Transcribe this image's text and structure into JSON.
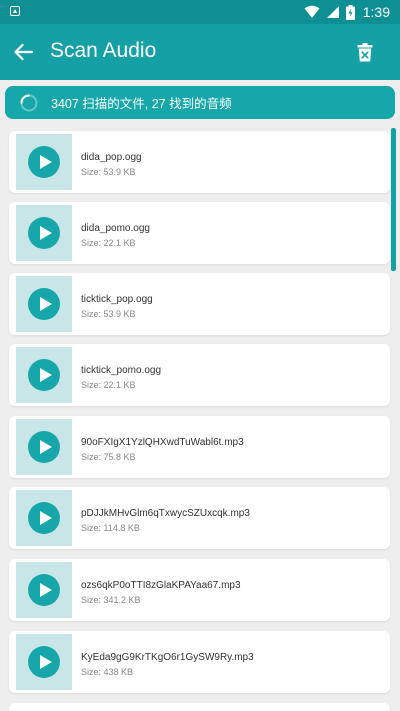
{
  "status_bar": {
    "time": "1:39"
  },
  "app_bar": {
    "title": "Scan Audio",
    "back_icon": "arrow-left-icon",
    "delete_icon": "trash-icon"
  },
  "progress": {
    "text": "3407 扫描的文件, 27 找到的音频"
  },
  "files": [
    {
      "name": "dida_pop.ogg",
      "size": "Size: 53.9 KB"
    },
    {
      "name": "dida_pomo.ogg",
      "size": "Size: 22.1 KB"
    },
    {
      "name": "ticktick_pop.ogg",
      "size": "Size: 53.9 KB"
    },
    {
      "name": "ticktick_pomo.ogg",
      "size": "Size: 22.1 KB"
    },
    {
      "name": "90oFXIgX1YzlQHXwdTuWabl6t.mp3",
      "size": "Size: 75.8 KB"
    },
    {
      "name": "pDJJkMHvGlm6qTxwycSZUxcqk.mp3",
      "size": "Size: 114.8 KB"
    },
    {
      "name": "ozs6qkP0oTTI8zGlaKPAYaa67.mp3",
      "size": "Size: 341.2 KB"
    },
    {
      "name": "KyEda9gG9KrTKgO6r1GySW9Ry.mp3",
      "size": "Size: 438 KB"
    }
  ],
  "colors": {
    "status_bar": "#0e8f93",
    "app_bar": "#14a0a4",
    "accent": "#17a6aa",
    "thumb_bg": "#c8e6e8"
  }
}
